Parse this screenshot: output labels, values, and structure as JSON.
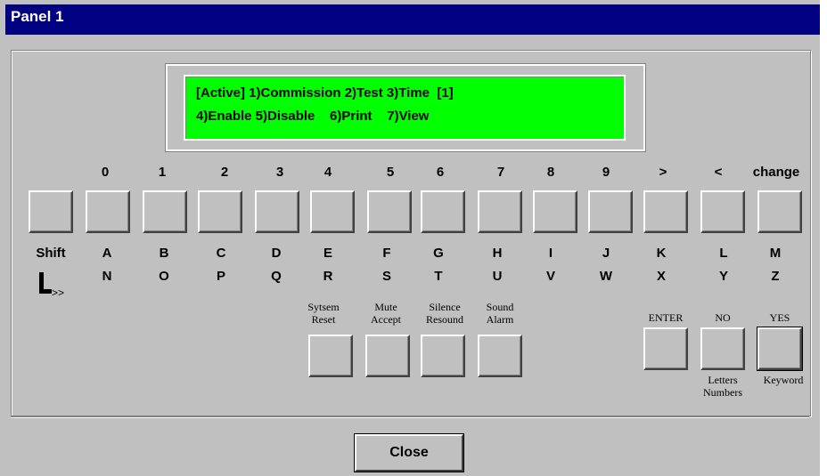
{
  "window": {
    "title": "Panel 1"
  },
  "display": {
    "line1": "[Active] 1)Commission 2)Test 3)Time  [1]",
    "line2": "4)Enable 5)Disable    6)Print    7)View"
  },
  "keypad": {
    "top_labels": [
      "0",
      "1",
      "2",
      "3",
      "4",
      "5",
      "6",
      "7",
      "8",
      "9",
      ">",
      "<",
      "change"
    ],
    "letter_row1": [
      "A",
      "B",
      "C",
      "D",
      "E",
      "F",
      "G",
      "H",
      "I",
      "J",
      "K",
      "L",
      "M"
    ],
    "letter_row2": [
      "N",
      "O",
      "P",
      "Q",
      "R",
      "S",
      "T",
      "U",
      "V",
      "W",
      "X",
      "Y",
      "Z"
    ],
    "shift_label": "Shift",
    "shift_arrow": ">>"
  },
  "function_keys": [
    {
      "line1": "Sytsem",
      "line2": "Reset"
    },
    {
      "line1": "Mute",
      "line2": "Accept"
    },
    {
      "line1": "Silence",
      "line2": "Resound"
    },
    {
      "line1": "Sound",
      "line2": "Alarm"
    }
  ],
  "mode_keys": {
    "enter": "ENTER",
    "no": "NO",
    "yes": "YES",
    "no_sub1": "Letters",
    "no_sub2": "Numbers",
    "yes_sub": "Keyword"
  },
  "footer": {
    "close_label": "Close"
  }
}
